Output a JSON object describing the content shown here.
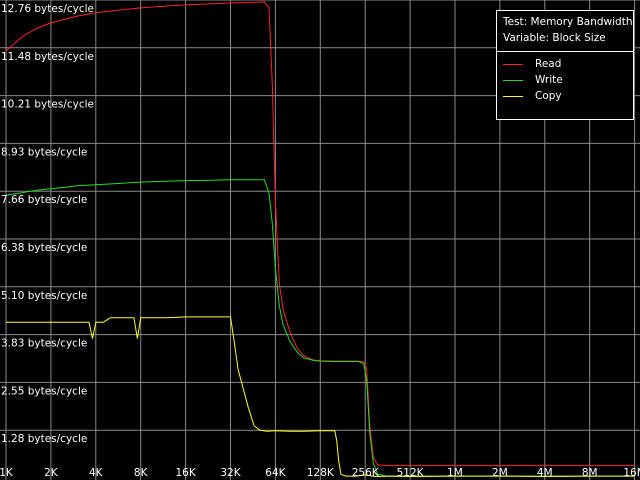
{
  "chart_data": {
    "type": "line",
    "title": "",
    "xlabel": "",
    "ylabel": "",
    "x_scale": "log2",
    "x_tick_labels": [
      "1K",
      "2K",
      "4K",
      "8K",
      "16K",
      "32K",
      "64K",
      "128K",
      "256K",
      "512K",
      "1M",
      "2M",
      "4M",
      "8M",
      "16M"
    ],
    "y_tick_labels": [
      "12.76 bytes/cycle",
      "11.48 bytes/cycle",
      "10.21 bytes/cycle",
      "8.93 bytes/cycle",
      "7.66 bytes/cycle",
      "6.38 bytes/cycle",
      "5.10 bytes/cycle",
      "3.83 bytes/cycle",
      "2.55 bytes/cycle",
      "1.28 bytes/cycle"
    ],
    "ylim": [
      0,
      12.76
    ],
    "grid": true,
    "legend_placement": "top-right",
    "series": [
      {
        "name": "Read",
        "color": "#ff2020",
        "points": [
          [
            1,
            11.4
          ],
          [
            1.3,
            11.8
          ],
          [
            1.6,
            12.0
          ],
          [
            2,
            12.15
          ],
          [
            2.5,
            12.25
          ],
          [
            3,
            12.33
          ],
          [
            4,
            12.42
          ],
          [
            6,
            12.5
          ],
          [
            8,
            12.55
          ],
          [
            12,
            12.6
          ],
          [
            16,
            12.63
          ],
          [
            24,
            12.66
          ],
          [
            32,
            12.68
          ],
          [
            48,
            12.7
          ],
          [
            54,
            12.71
          ],
          [
            58,
            12.55
          ],
          [
            61,
            10.5
          ],
          [
            64,
            7.4
          ],
          [
            68,
            5.2
          ],
          [
            72,
            4.5
          ],
          [
            80,
            3.9
          ],
          [
            90,
            3.45
          ],
          [
            100,
            3.25
          ],
          [
            115,
            3.15
          ],
          [
            128,
            3.13
          ],
          [
            160,
            3.12
          ],
          [
            200,
            3.12
          ],
          [
            230,
            3.12
          ],
          [
            250,
            3.1
          ],
          [
            262,
            2.9
          ],
          [
            275,
            1.4
          ],
          [
            290,
            0.55
          ],
          [
            310,
            0.35
          ],
          [
            360,
            0.33
          ],
          [
            512,
            0.33
          ],
          [
            1024,
            0.33
          ],
          [
            2048,
            0.33
          ],
          [
            4096,
            0.33
          ],
          [
            8192,
            0.33
          ],
          [
            16384,
            0.33
          ]
        ]
      },
      {
        "name": "Write",
        "color": "#20e020",
        "points": [
          [
            1,
            7.55
          ],
          [
            1.3,
            7.62
          ],
          [
            1.6,
            7.68
          ],
          [
            2,
            7.72
          ],
          [
            2.5,
            7.76
          ],
          [
            3,
            7.8
          ],
          [
            4,
            7.83
          ],
          [
            6,
            7.87
          ],
          [
            8,
            7.9
          ],
          [
            12,
            7.92
          ],
          [
            16,
            7.94
          ],
          [
            24,
            7.95
          ],
          [
            32,
            7.96
          ],
          [
            48,
            7.96
          ],
          [
            54,
            7.96
          ],
          [
            58,
            7.6
          ],
          [
            61,
            6.8
          ],
          [
            64,
            5.6
          ],
          [
            68,
            4.6
          ],
          [
            72,
            4.1
          ],
          [
            80,
            3.65
          ],
          [
            90,
            3.35
          ],
          [
            100,
            3.2
          ],
          [
            115,
            3.14
          ],
          [
            128,
            3.12
          ],
          [
            160,
            3.11
          ],
          [
            200,
            3.11
          ],
          [
            230,
            3.11
          ],
          [
            250,
            3.05
          ],
          [
            262,
            2.6
          ],
          [
            275,
            1.2
          ],
          [
            290,
            0.4
          ],
          [
            310,
            0.1
          ],
          [
            360,
            0.05
          ],
          [
            512,
            0.05
          ],
          [
            1024,
            0.05
          ],
          [
            2048,
            0.05
          ],
          [
            4096,
            0.05
          ],
          [
            8192,
            0.05
          ],
          [
            16384,
            0.05
          ]
        ]
      },
      {
        "name": "Copy",
        "color": "#ffff20",
        "points": [
          [
            1,
            4.16
          ],
          [
            2,
            4.16
          ],
          [
            3.6,
            4.16
          ],
          [
            3.8,
            3.72
          ],
          [
            4.0,
            4.16
          ],
          [
            4.5,
            4.16
          ],
          [
            5,
            4.28
          ],
          [
            6,
            4.28
          ],
          [
            7.2,
            4.28
          ],
          [
            7.6,
            3.72
          ],
          [
            8.0,
            4.28
          ],
          [
            12,
            4.28
          ],
          [
            16,
            4.3
          ],
          [
            24,
            4.3
          ],
          [
            32,
            4.3
          ],
          [
            34,
            3.6
          ],
          [
            36,
            2.9
          ],
          [
            38,
            2.55
          ],
          [
            42,
            1.9
          ],
          [
            46,
            1.4
          ],
          [
            50,
            1.28
          ],
          [
            56,
            1.25
          ],
          [
            64,
            1.26
          ],
          [
            80,
            1.25
          ],
          [
            100,
            1.25
          ],
          [
            128,
            1.26
          ],
          [
            150,
            1.26
          ],
          [
            160,
            1.26
          ],
          [
            165,
            1.0
          ],
          [
            170,
            0.45
          ],
          [
            176,
            0.1
          ],
          [
            190,
            0.05
          ],
          [
            220,
            0.05
          ],
          [
            256,
            0.08
          ],
          [
            300,
            0.04
          ],
          [
            400,
            0.05
          ],
          [
            512,
            0.04
          ],
          [
            1024,
            0.05
          ],
          [
            2048,
            0.05
          ],
          [
            4096,
            0.04
          ],
          [
            8192,
            0.05
          ],
          [
            16384,
            0.05
          ]
        ]
      }
    ]
  },
  "legend": {
    "test_label": "Test: Memory Bandwidth",
    "variable_label": "Variable: Block Size"
  }
}
